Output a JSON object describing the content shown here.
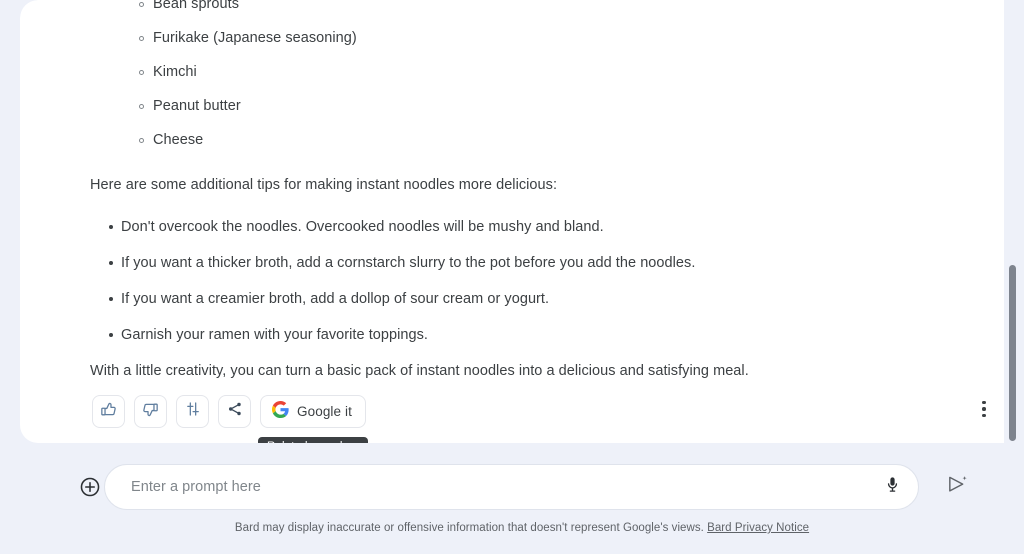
{
  "app": {
    "name": "Bard",
    "accent": "#4285f4",
    "card_bg": "#ffffff",
    "page_bg": "#eef1f9",
    "text_color": "#3c4043"
  },
  "response": {
    "topping_list": [
      {
        "label": "Bean sprouts"
      },
      {
        "label": "Furikake (Japanese seasoning)"
      },
      {
        "label": "Kimchi"
      },
      {
        "label": "Peanut butter"
      },
      {
        "label": "Cheese"
      }
    ],
    "tips_intro": "Here are some additional tips for making instant noodles more delicious:",
    "tips_list": [
      {
        "label": "Don't overcook the noodles. Overcooked noodles will be mushy and bland."
      },
      {
        "label": "If you want a thicker broth, add a cornstarch slurry to the pot before you add the noodles."
      },
      {
        "label": "If you want a creamier broth, add a dollop of sour cream or yogurt."
      },
      {
        "label": "Garnish your ramen with your favorite toppings."
      }
    ],
    "closing": "With a little creativity, you can turn a basic pack of instant noodles into a delicious and satisfying meal."
  },
  "actions": {
    "thumb_up": {
      "icon": "thumb-up-icon",
      "label": "Good response"
    },
    "thumb_down": {
      "icon": "thumb-down-icon",
      "label": "Bad response"
    },
    "modify": {
      "icon": "tune-icon",
      "label": "Modify response"
    },
    "share": {
      "icon": "share-icon",
      "label": "Share & export"
    },
    "google_it": {
      "icon": "google-logo-icon",
      "label": "Google it"
    },
    "more": {
      "icon": "more-vert-icon",
      "label": "More"
    }
  },
  "tooltip": {
    "text": "Related searches"
  },
  "composer": {
    "add_icon": "plus-circle-icon",
    "placeholder": "Enter a prompt here",
    "value": "",
    "mic_icon": "microphone-icon",
    "send_icon": "send-sparkle-icon"
  },
  "footer": {
    "disclaimer": "Bard may display inaccurate or offensive information that doesn't represent Google's views.",
    "privacy_link": "Bard Privacy Notice"
  },
  "scrollbar": {
    "orientation": "vertical"
  }
}
